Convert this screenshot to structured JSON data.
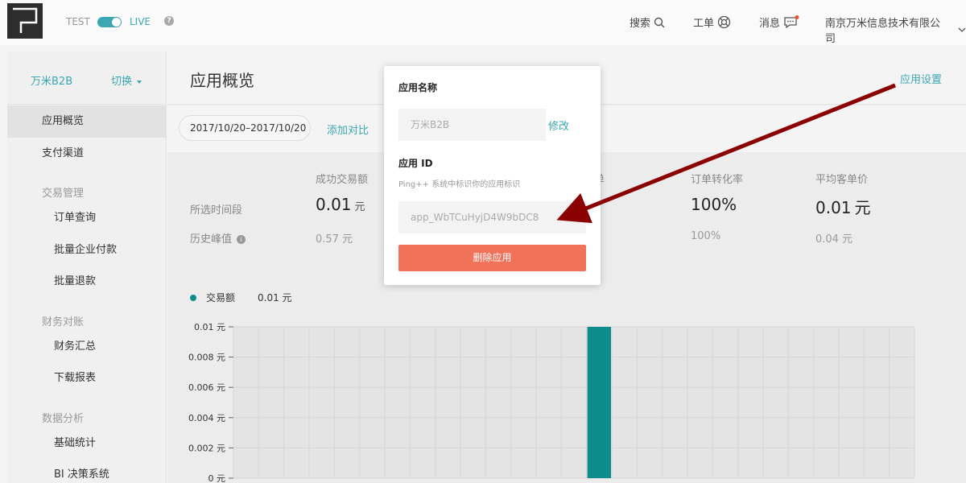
{
  "topbar": {
    "env_test": "TEST",
    "env_live": "LIVE",
    "search_label": "搜索",
    "ticket_label": "工单",
    "messages_label": "消息",
    "company_label": "南京万米信息技术有限公司",
    "accent_color": "#3aa7b2"
  },
  "sidebar": {
    "app_name": "万米B2B",
    "switch_label": "切换",
    "links": {
      "overview": "应用概览",
      "payment_channels": "支付渠道",
      "transactions_group": "交易管理",
      "order_query": "订单查询",
      "batch_corp_pay": "批量企业付款",
      "batch_refund": "批量退款",
      "finance_group": "财务对账",
      "finance_summary": "财务汇总",
      "download_reports": "下载报表",
      "analytics_group": "数据分析",
      "basic_stats": "基础统计",
      "bi_system": "BI 决策系统"
    }
  },
  "main": {
    "title": "应用概览",
    "app_settings": "应用设置",
    "date_range": "2017/10/20–2017/10/20",
    "add_compare": "添加对比",
    "stats": {
      "head_success_amount": "成功交易额",
      "head_orders_fragment": "单",
      "head_conversion": "订单转化率",
      "head_avg_price": "平均客单价",
      "row_selected": "所选时间段",
      "row_history": "历史峰值",
      "success_amount_value": "0.01",
      "success_amount_unit": "元",
      "success_amount_peak": "0.57 元",
      "conversion_value": "100%",
      "conversion_peak": "100%",
      "avg_price_value": "0.01",
      "avg_price_unit": "元",
      "avg_price_peak": "0.04 元"
    },
    "legend": {
      "series": "交易额",
      "value": "0.01 元"
    }
  },
  "chart_data": {
    "type": "bar",
    "series": [
      {
        "name": "交易额",
        "values": [
          0,
          0,
          0,
          0,
          0,
          0,
          0,
          0,
          0,
          0,
          0,
          0,
          0,
          0,
          0.01,
          0,
          0,
          0,
          0,
          0,
          0,
          0,
          0,
          0,
          0,
          0,
          0
        ]
      }
    ],
    "y_ticks": [
      "0.01 元",
      "0.008 元",
      "0.006 元",
      "0.004 元",
      "0.002 元",
      "0 元"
    ],
    "ylim": [
      0,
      0.01
    ],
    "grid": true,
    "color": "#0e8c8c"
  },
  "modal": {
    "app_name_label": "应用名称",
    "app_name_value": "万米B2B",
    "edit_label": "修改",
    "app_id_label": "应用 ID",
    "app_id_help": "Ping++ 系统中标识你的应用标识",
    "app_id_value": "app_WbTCuHyjD4W9bDC8",
    "delete_label": "删除应用",
    "delete_color": "#f07258"
  }
}
